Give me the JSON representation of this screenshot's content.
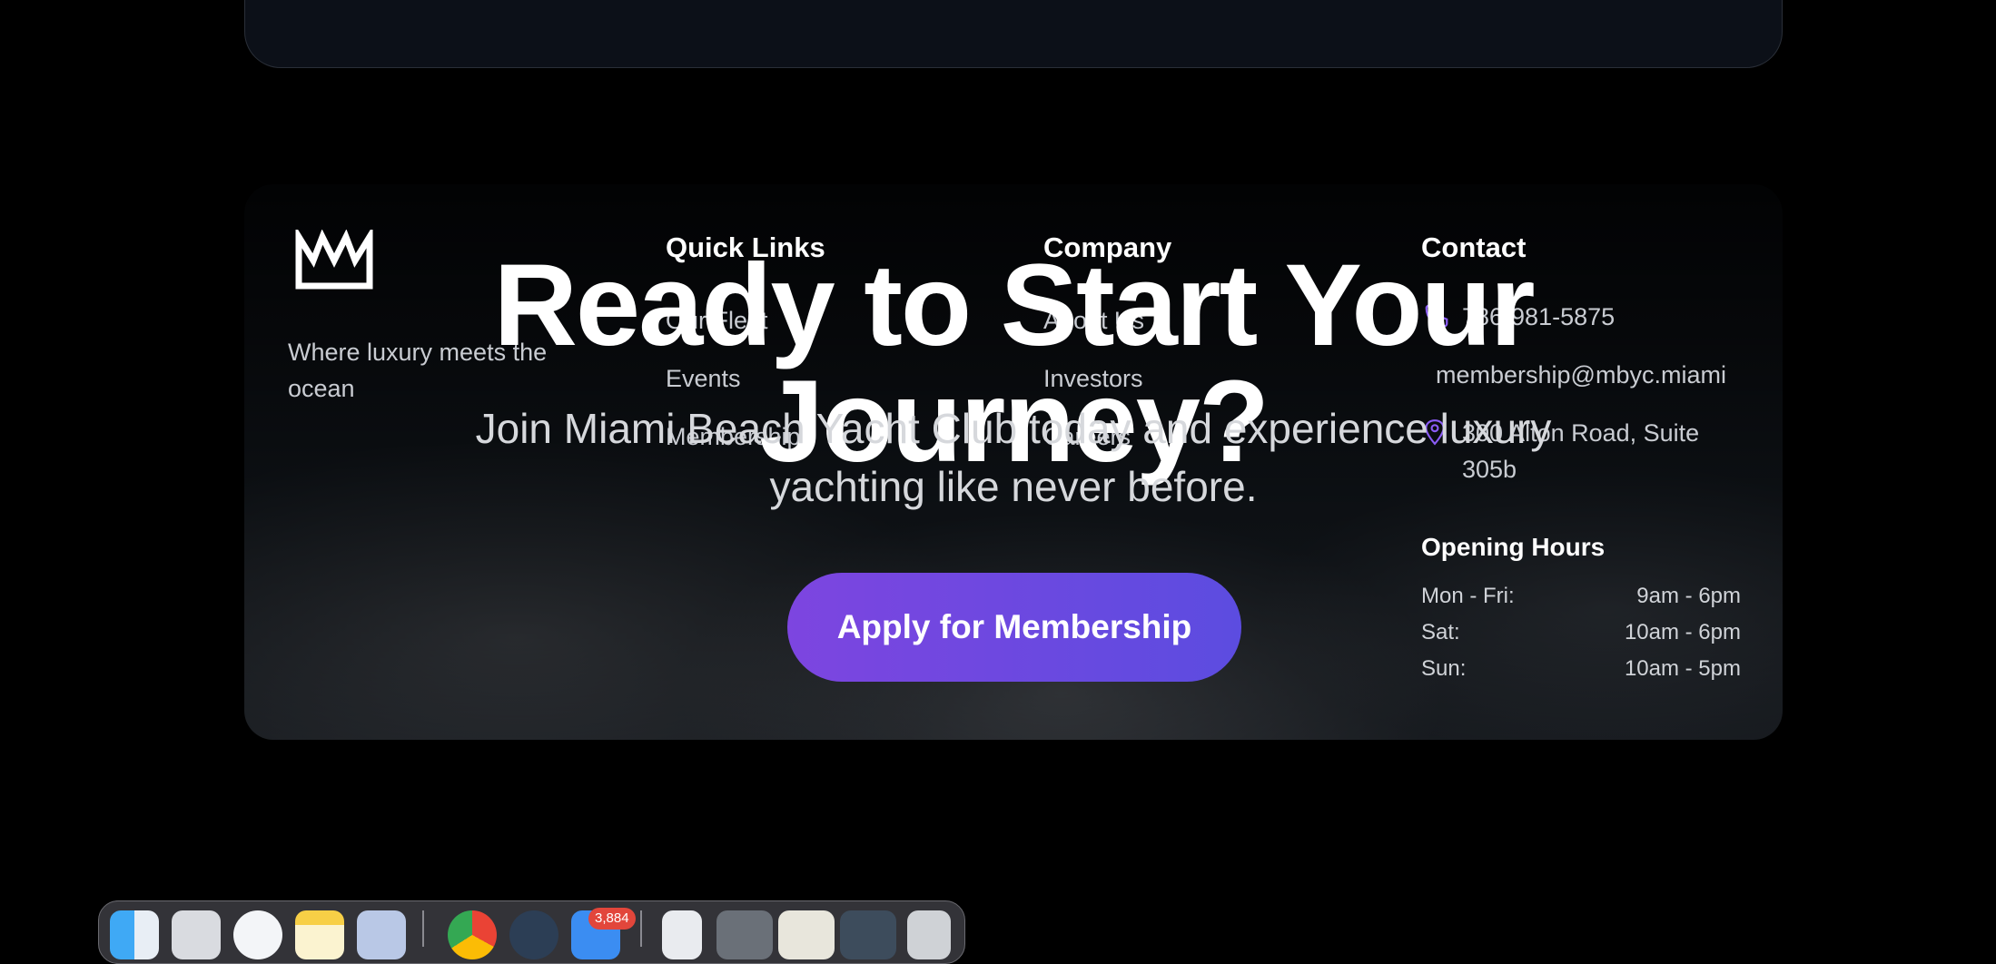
{
  "footer": {
    "brand": {
      "tagline": "Where luxury meets the ocean"
    },
    "quick_links": {
      "title": "Quick Links",
      "items": [
        "Our Fleet",
        "Events",
        "Membership"
      ]
    },
    "company": {
      "title": "Company",
      "items": [
        "About Us",
        "Investors",
        "Careers"
      ]
    },
    "contact": {
      "title": "Contact",
      "phone": "786-981-5875",
      "email": "membership@mbyc.miami",
      "address": "300 Alton Road, Suite 305b"
    },
    "hours": {
      "title": "Opening Hours",
      "rows": [
        {
          "day": "Mon - Fri:",
          "time": "9am - 6pm"
        },
        {
          "day": "Sat:",
          "time": "10am - 6pm"
        },
        {
          "day": "Sun:",
          "time": "10am - 5pm"
        }
      ]
    }
  },
  "cta": {
    "title": "Ready to Start Your Journey?",
    "subtitle": "Join Miami Beach Yacht Club today and experience luxury yachting like never before.",
    "button": "Apply for Membership"
  },
  "dock": {
    "mail_badge": "3,884",
    "icons": [
      "finder-icon",
      "launchpad-icon",
      "safari-icon",
      "notes-icon",
      "preview-icon",
      "chrome-icon",
      "maps-icon",
      "mail-icon",
      "document-icon",
      "screenshot-icon",
      "document-preview-icon",
      "screenshot-icon",
      "trash-icon"
    ]
  },
  "colors": {
    "accent_purple": "#7d45e0",
    "accent_indigo": "#5c4ce0",
    "icon_purple": "#8b5cf6"
  }
}
